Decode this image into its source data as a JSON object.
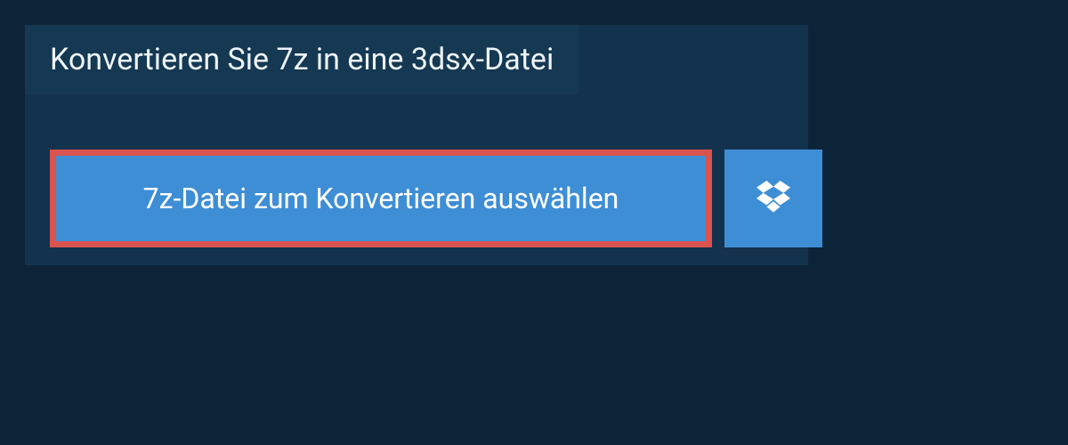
{
  "header": {
    "title": "Konvertieren Sie 7z in eine 3dsx-Datei"
  },
  "actions": {
    "select_file_label": "7z-Datei zum Konvertieren auswählen",
    "dropbox_icon": "dropbox-icon"
  },
  "colors": {
    "page_bg": "#0d2438",
    "panel_bg": "#13324d",
    "header_bg": "#153853",
    "button_bg": "#3e8ed6",
    "highlight_border": "#d9534f",
    "text_light": "#eef4f9",
    "text_white": "#ffffff"
  }
}
